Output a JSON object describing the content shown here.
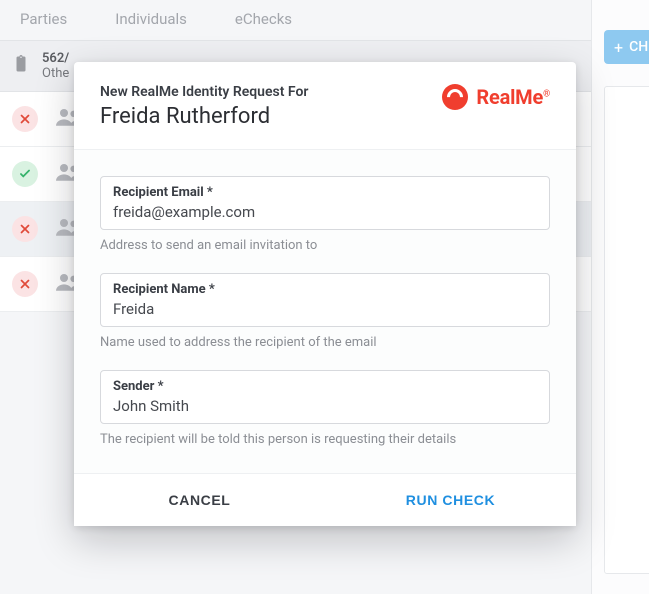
{
  "tabs": {
    "parties": "Parties",
    "individuals": "Individuals",
    "echecks": "eChecks"
  },
  "bar": {
    "num": "562/",
    "sub": "Othe"
  },
  "check_button": {
    "plus": "+",
    "label": "CH"
  },
  "modal": {
    "subtitle": "New RealMe Identity Request For",
    "person": "Freida Rutherford",
    "brand": "RealMe",
    "brand_reg": "®",
    "fields": {
      "email": {
        "label": "Recipient Email *",
        "value": "freida@example.com",
        "hint": "Address to send an email invitation to"
      },
      "name": {
        "label": "Recipient Name *",
        "value": "Freida",
        "hint": "Name used to address the recipient of the email"
      },
      "sender": {
        "label": "Sender *",
        "value": "John Smith",
        "hint": "The recipient will be told this person is requesting their details"
      }
    },
    "buttons": {
      "cancel": "CANCEL",
      "run": "RUN CHECK"
    }
  }
}
